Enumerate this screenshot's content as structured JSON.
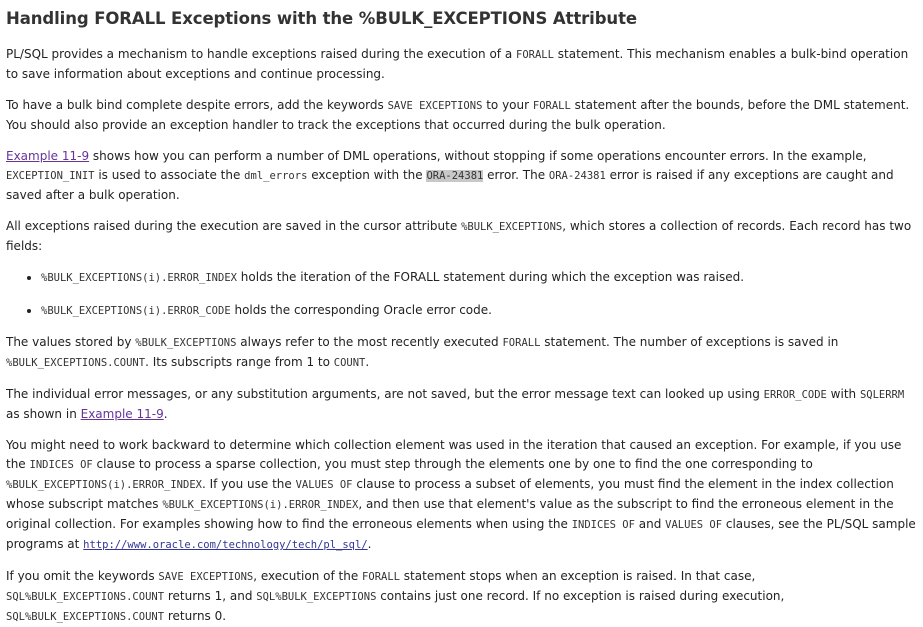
{
  "heading": "Handling FORALL Exceptions with the %BULK_EXCEPTIONS Attribute",
  "p1": {
    "t1": "PL/SQL provides a mechanism to handle exceptions raised during the execution of a ",
    "c1": "FORALL",
    "t2": " statement. This mechanism enables a bulk-bind operation to save information about exceptions and continue processing."
  },
  "p2": {
    "t1": "To have a bulk bind complete despite errors, add the keywords ",
    "c1": "SAVE EXCEPTIONS",
    "t2": " to your ",
    "c2": "FORALL",
    "t3": " statement after the bounds, before the DML statement. You should also provide an exception handler to track the exceptions that occurred during the bulk operation."
  },
  "p3": {
    "link": "Example 11-9",
    "t1": " shows how you can perform a number of DML operations, without stopping if some operations encounter errors. In the example, ",
    "c1": "EXCEPTION_INIT",
    "t2": " is used to associate the ",
    "c2": "dml_errors",
    "t3": " exception with the ",
    "c3": "ORA-24381",
    "t4": " error. The ",
    "c4": "ORA-24381",
    "t5": " error is raised if any exceptions are caught and saved after a bulk operation."
  },
  "p4": {
    "t1": "All exceptions raised during the execution are saved in the cursor attribute ",
    "c1": "%BULK_EXCEPTIONS",
    "t2": ", which stores a collection of records. Each record has two fields:"
  },
  "bullets": [
    {
      "c": "%BULK_EXCEPTIONS(i).ERROR_INDEX",
      "t": " holds the iteration of the FORALL statement during which the exception was raised."
    },
    {
      "c": "%BULK_EXCEPTIONS(i).ERROR_CODE",
      "t": " holds the corresponding Oracle error code."
    }
  ],
  "p5": {
    "t1": "The values stored by ",
    "c1": "%BULK_EXCEPTIONS",
    "t2": " always refer to the most recently executed ",
    "c2": "FORALL",
    "t3": " statement. The number of exceptions is saved in ",
    "c3": "%BULK_EXCEPTIONS.COUNT",
    "t4": ". Its subscripts range from 1 to ",
    "c4": "COUNT",
    "t5": "."
  },
  "p6": {
    "t1": "The individual error messages, or any substitution arguments, are not saved, but the error message text can looked up using ",
    "c1": "ERROR_CODE",
    "t2": " with ",
    "c2": "SQLERRM",
    "t3": " as shown in ",
    "link": "Example 11-9",
    "t4": "."
  },
  "p7": {
    "t1": "You might need to work backward to determine which collection element was used in the iteration that caused an exception. For example, if you use the ",
    "c1": "INDICES OF",
    "t2": " clause to process a sparse collection, you must step through the elements one by one to find the one corresponding to ",
    "c2": "%BULK_EXCEPTIONS(i).ERROR_INDEX",
    "t3": ". If you use the ",
    "c3": "VALUES OF",
    "t4": " clause to process a subset of elements, you must find the element in the index collection whose subscript matches ",
    "c4": "%BULK_EXCEPTIONS(i).ERROR_INDEX",
    "t5": ", and then use that element's value as the subscript to find the erroneous element in the original collection. For examples showing how to find the erroneous elements when using the ",
    "c5": "INDICES OF",
    "t6": " and ",
    "c6": "VALUES OF",
    "t7": " clauses, see the PL/SQL sample programs at ",
    "url": "http://www.oracle.com/technology/tech/pl_sql/",
    "t8": "."
  },
  "p8": {
    "t1": "If you omit the keywords ",
    "c1": "SAVE EXCEPTIONS",
    "t2": ", execution of the ",
    "c2": "FORALL",
    "t3": " statement stops when an exception is raised. In that case, ",
    "c3": "SQL%BULK_EXCEPTIONS.COUNT",
    "t4": " returns 1, and ",
    "c4": "SQL%BULK_EXCEPTIONS",
    "t5": " contains just one record. If no exception is raised during execution, ",
    "c5": "SQL%BULK_EXCEPTIONS.COUNT",
    "t6": " returns 0."
  }
}
